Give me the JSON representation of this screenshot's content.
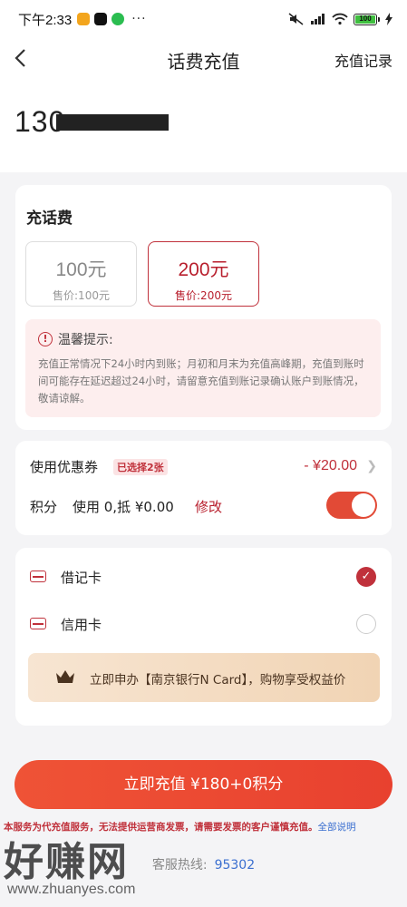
{
  "status_bar": {
    "time": "下午2:33",
    "dots": "···",
    "battery": "100",
    "apps": [
      {
        "name": "notes-app-icon",
        "color": "#f3a51d"
      },
      {
        "name": "tiktok-app-icon",
        "color": "#111111"
      },
      {
        "name": "wechat-app-icon",
        "color": "#2bbd50"
      }
    ]
  },
  "nav": {
    "title": "话费充值",
    "right_link": "充值记录"
  },
  "phone": {
    "number_prefix": "130"
  },
  "recharge": {
    "section_title": "充话费",
    "options": [
      {
        "amount": "100元",
        "price": "售价:100元",
        "selected": false
      },
      {
        "amount": "200元",
        "price": "售价:200元",
        "selected": true
      }
    ],
    "tip_title": "温馨提示:",
    "tip_body": "充值正常情况下24小时内到账；月初和月末为充值高峰期，充值到账时间可能存在延迟超过24小时，请留意充值到账记录确认账户到账情况，敬请谅解。"
  },
  "discounts": {
    "coupon_label": "使用优惠券",
    "coupon_badge": "已选择2张",
    "coupon_value": "- ¥20.00",
    "points_label": "积分",
    "points_detail": "使用 0,抵 ¥0.00",
    "points_edit": "修改",
    "points_toggle_on": true
  },
  "payment": {
    "methods": [
      {
        "label": "借记卡",
        "selected": true
      },
      {
        "label": "信用卡",
        "selected": false
      }
    ],
    "promo_text": "立即申办【南京银行N Card】，购物享受权益价"
  },
  "cta_label": "立即充值 ¥180+0积分",
  "disclaimer": {
    "text": "本服务为代充值服务，无法提供运营商发票，请需要发票的客户谨慎充值。",
    "link": "全部说明"
  },
  "hotline": {
    "label": "客服热线:",
    "number": "95302"
  },
  "watermark": {
    "big": "好赚网",
    "small": "www.zhuanyes.com"
  },
  "colors": {
    "accent": "#c0313b",
    "cta": "#e8412f",
    "link": "#3b6fd0"
  }
}
